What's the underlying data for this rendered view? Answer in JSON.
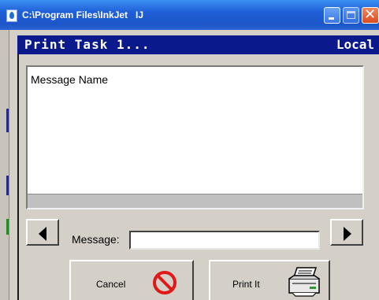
{
  "window": {
    "title": "C:\\Program Files\\InkJet   IJ"
  },
  "header": {
    "title": "Print Task 1...",
    "location": "Local"
  },
  "list": {
    "column_header": "Message Name"
  },
  "message": {
    "label": "Message:",
    "value": ""
  },
  "buttons": {
    "cancel_label": "Cancel",
    "print_label": "Print It"
  },
  "icons": {
    "cancel": "no-entry-icon",
    "print": "printer-icon",
    "prev": "arrow-left-icon",
    "next": "arrow-right-icon"
  },
  "colors": {
    "titlebar": "#1f5fd8",
    "header": "#0a1a8c",
    "cancel_icon": "#e01818"
  }
}
